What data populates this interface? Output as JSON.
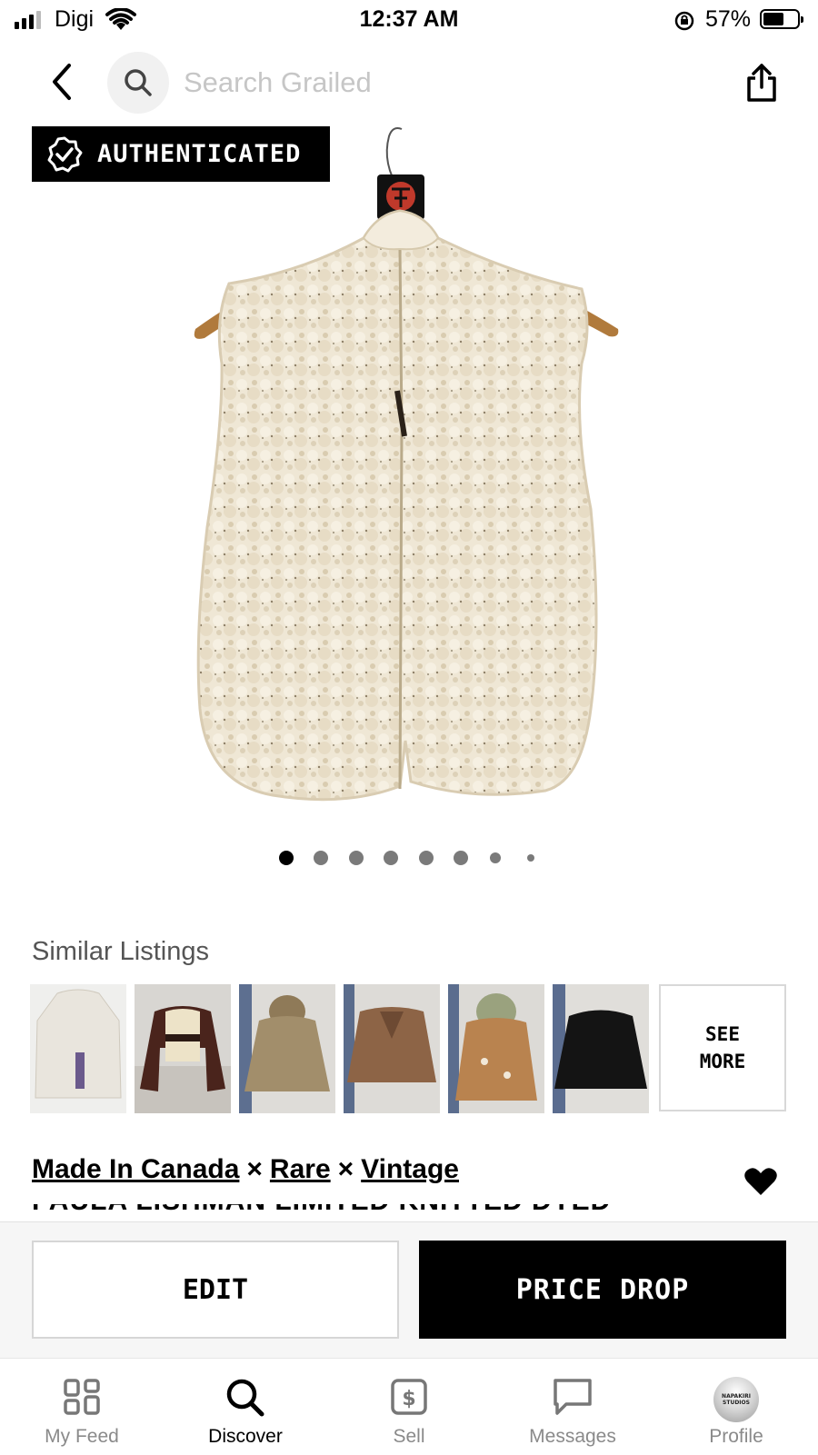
{
  "status_bar": {
    "carrier": "Digi",
    "time": "12:37 AM",
    "battery_percent": "57%"
  },
  "header": {
    "search_placeholder": "Search Grailed"
  },
  "product": {
    "badge": "AUTHENTICATED",
    "image_count": 8,
    "active_image": 1,
    "brands": [
      "Made In Canada",
      "Rare",
      "Vintage"
    ],
    "brand_separator": "×",
    "title_partial": "PAULA LISHMAN LIMITED KNITTED DYED"
  },
  "similar": {
    "title": "Similar Listings",
    "see_more_line1": "SEE",
    "see_more_line2": "MORE"
  },
  "actions": {
    "edit": "EDIT",
    "price_drop": "PRICE DROP"
  },
  "tabs": [
    {
      "label": "My Feed",
      "icon": "feed-icon"
    },
    {
      "label": "Discover",
      "icon": "search-icon"
    },
    {
      "label": "Sell",
      "icon": "sell-icon"
    },
    {
      "label": "Messages",
      "icon": "messages-icon"
    },
    {
      "label": "Profile",
      "icon": "avatar"
    }
  ],
  "profile_avatar_text": [
    "NAPAKIRI",
    "STUDIOS"
  ],
  "colors": {
    "accent": "#000000",
    "inactive": "#8a8a8a",
    "vest": "#eee5d3"
  }
}
